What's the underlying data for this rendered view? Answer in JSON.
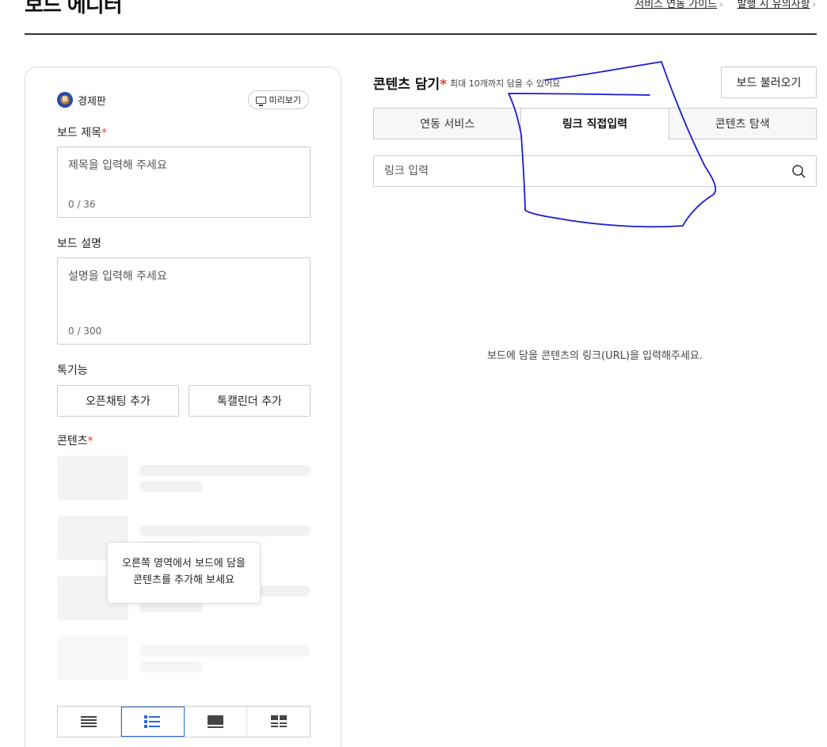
{
  "header": {
    "title": "보드 에디터",
    "links": [
      "서비스 연동 가이드",
      "발행 시 유의사항"
    ]
  },
  "editor": {
    "channel_name": "경제판",
    "channel_avatar_text": "B",
    "preview_label": "미리보기",
    "board_title_label": "보드 제목",
    "title_placeholder": "제목을 입력해 주세요",
    "title_count": "0 / 36",
    "board_desc_label": "보드 설명",
    "desc_placeholder": "설명을 입력해 주세요",
    "desc_count": "0 / 300",
    "talk_label": "톡기능",
    "openchat_button": "오픈채팅 추가",
    "talkcal_button": "톡캘린더 추가",
    "content_label": "콘텐츠",
    "required_mark": "*",
    "tooltip_line1": "오른쪽 영역에서 보드에 담을",
    "tooltip_line2": "콘텐츠를 추가해 보세요",
    "layout_options": [
      "list-icon",
      "thumb-list-icon",
      "card-icon",
      "grid-icon"
    ],
    "layout_selected": 1
  },
  "content_panel": {
    "title": "콘텐츠 담기",
    "subtitle": "최대 10개까지 담을 수 있어요",
    "load_button": "보드 불러오기",
    "tabs": [
      "연동 서비스",
      "링크 직접입력",
      "콘텐츠 탐색"
    ],
    "active_tab": 1,
    "link_placeholder": "링크 입력",
    "empty_message": "보드에 담을 콘텐츠의 링크(URL)을 입력해주세요."
  },
  "colors": {
    "required": "#e83e30",
    "active_layout": "#2a6ad8",
    "scribble": "#1a1ad8"
  }
}
